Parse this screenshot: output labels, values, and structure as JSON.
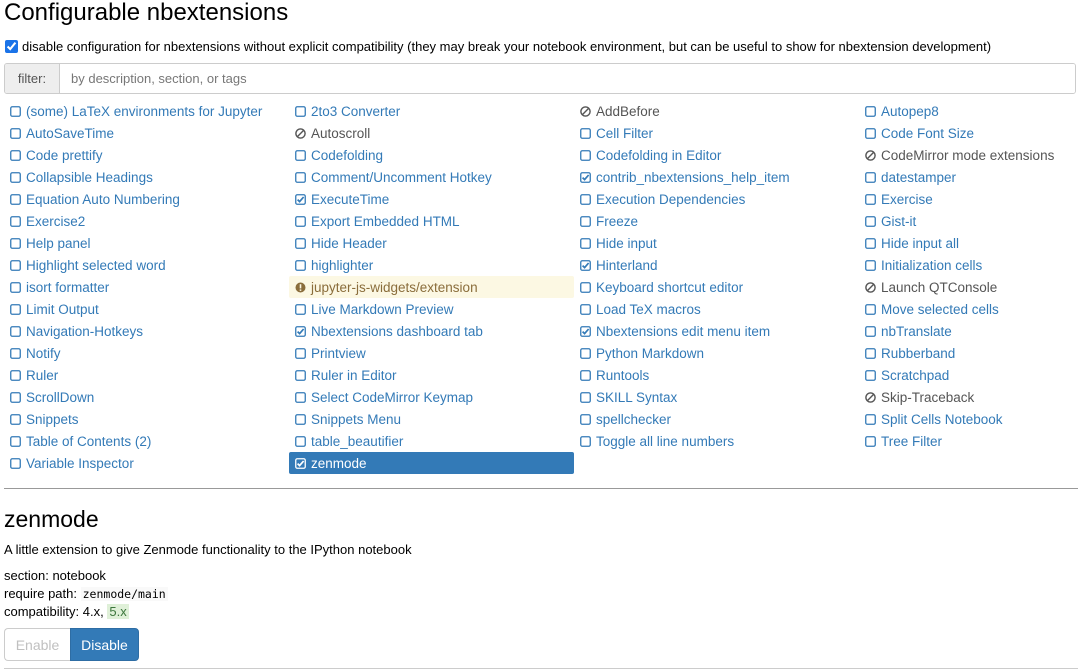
{
  "page": {
    "title": "Configurable nbextensions",
    "disable_config_label": "disable configuration for nbextensions without explicit compatibility (they may break your notebook environment, but can be useful to show for nbextension development)",
    "disable_config_checked": true,
    "filter_label": "filter:",
    "filter_placeholder": "by description, section, or tags"
  },
  "icons": {
    "unchecked": "square-outline-icon",
    "checked": "checked-square-icon",
    "unconfigurable": "ban-icon",
    "warning": "exclamation-circle-icon"
  },
  "colors": {
    "link": "#337ab7",
    "selected_bg": "#337ab7",
    "warning_bg": "#fcf8e3",
    "compat_ok_bg": "#dff0d8"
  },
  "extensions": {
    "columns": [
      [
        {
          "label": "(some) LaTeX environments for Jupyter",
          "state": "unchecked"
        },
        {
          "label": "AutoSaveTime",
          "state": "unchecked"
        },
        {
          "label": "Code prettify",
          "state": "unchecked"
        },
        {
          "label": "Collapsible Headings",
          "state": "unchecked"
        },
        {
          "label": "Equation Auto Numbering",
          "state": "unchecked"
        },
        {
          "label": "Exercise2",
          "state": "unchecked"
        },
        {
          "label": "Help panel",
          "state": "unchecked"
        },
        {
          "label": "Highlight selected word",
          "state": "unchecked"
        },
        {
          "label": "isort formatter",
          "state": "unchecked"
        },
        {
          "label": "Limit Output",
          "state": "unchecked"
        },
        {
          "label": "Navigation-Hotkeys",
          "state": "unchecked"
        },
        {
          "label": "Notify",
          "state": "unchecked"
        },
        {
          "label": "Ruler",
          "state": "unchecked"
        },
        {
          "label": "ScrollDown",
          "state": "unchecked"
        },
        {
          "label": "Snippets",
          "state": "unchecked"
        },
        {
          "label": "Table of Contents (2)",
          "state": "unchecked"
        },
        {
          "label": "Variable Inspector",
          "state": "unchecked"
        }
      ],
      [
        {
          "label": "2to3 Converter",
          "state": "unchecked"
        },
        {
          "label": "Autoscroll",
          "state": "unconfigurable"
        },
        {
          "label": "Codefolding",
          "state": "unchecked"
        },
        {
          "label": "Comment/Uncomment Hotkey",
          "state": "unchecked"
        },
        {
          "label": "ExecuteTime",
          "state": "checked"
        },
        {
          "label": "Export Embedded HTML",
          "state": "unchecked"
        },
        {
          "label": "Hide Header",
          "state": "unchecked"
        },
        {
          "label": "highlighter",
          "state": "unchecked"
        },
        {
          "label": "jupyter-js-widgets/extension",
          "state": "warning"
        },
        {
          "label": "Live Markdown Preview",
          "state": "unchecked"
        },
        {
          "label": "Nbextensions dashboard tab",
          "state": "checked"
        },
        {
          "label": "Printview",
          "state": "unchecked"
        },
        {
          "label": "Ruler in Editor",
          "state": "unchecked"
        },
        {
          "label": "Select CodeMirror Keymap",
          "state": "unchecked"
        },
        {
          "label": "Snippets Menu",
          "state": "unchecked"
        },
        {
          "label": "table_beautifier",
          "state": "unchecked"
        },
        {
          "label": "zenmode",
          "state": "checked",
          "selected": true
        }
      ],
      [
        {
          "label": "AddBefore",
          "state": "unconfigurable"
        },
        {
          "label": "Cell Filter",
          "state": "unchecked"
        },
        {
          "label": "Codefolding in Editor",
          "state": "unchecked"
        },
        {
          "label": "contrib_nbextensions_help_item",
          "state": "checked"
        },
        {
          "label": "Execution Dependencies",
          "state": "unchecked"
        },
        {
          "label": "Freeze",
          "state": "unchecked"
        },
        {
          "label": "Hide input",
          "state": "unchecked"
        },
        {
          "label": "Hinterland",
          "state": "checked"
        },
        {
          "label": "Keyboard shortcut editor",
          "state": "unchecked"
        },
        {
          "label": "Load TeX macros",
          "state": "unchecked"
        },
        {
          "label": "Nbextensions edit menu item",
          "state": "checked"
        },
        {
          "label": "Python Markdown",
          "state": "unchecked"
        },
        {
          "label": "Runtools",
          "state": "unchecked"
        },
        {
          "label": "SKILL Syntax",
          "state": "unchecked"
        },
        {
          "label": "spellchecker",
          "state": "unchecked"
        },
        {
          "label": "Toggle all line numbers",
          "state": "unchecked"
        }
      ],
      [
        {
          "label": "Autopep8",
          "state": "unchecked"
        },
        {
          "label": "Code Font Size",
          "state": "unchecked"
        },
        {
          "label": "CodeMirror mode extensions",
          "state": "unconfigurable"
        },
        {
          "label": "datestamper",
          "state": "unchecked"
        },
        {
          "label": "Exercise",
          "state": "unchecked"
        },
        {
          "label": "Gist-it",
          "state": "unchecked"
        },
        {
          "label": "Hide input all",
          "state": "unchecked"
        },
        {
          "label": "Initialization cells",
          "state": "unchecked"
        },
        {
          "label": "Launch QTConsole",
          "state": "unconfigurable"
        },
        {
          "label": "Move selected cells",
          "state": "unchecked"
        },
        {
          "label": "nbTranslate",
          "state": "unchecked"
        },
        {
          "label": "Rubberband",
          "state": "unchecked"
        },
        {
          "label": "Scratchpad",
          "state": "unchecked"
        },
        {
          "label": "Skip-Traceback",
          "state": "unconfigurable"
        },
        {
          "label": "Split Cells Notebook",
          "state": "unchecked"
        },
        {
          "label": "Tree Filter",
          "state": "unchecked"
        }
      ]
    ]
  },
  "detail": {
    "title": "zenmode",
    "description": "A little extension to give Zenmode functionality to the IPython notebook",
    "section_label": "section:",
    "section_value": "notebook",
    "require_label": "require path:",
    "require_value": "zenmode/main",
    "compat_label": "compatibility:",
    "compat_v1": "4.x",
    "compat_sep": ",",
    "compat_v2": "5.x",
    "enable_label": "Enable",
    "disable_label": "Disable"
  }
}
